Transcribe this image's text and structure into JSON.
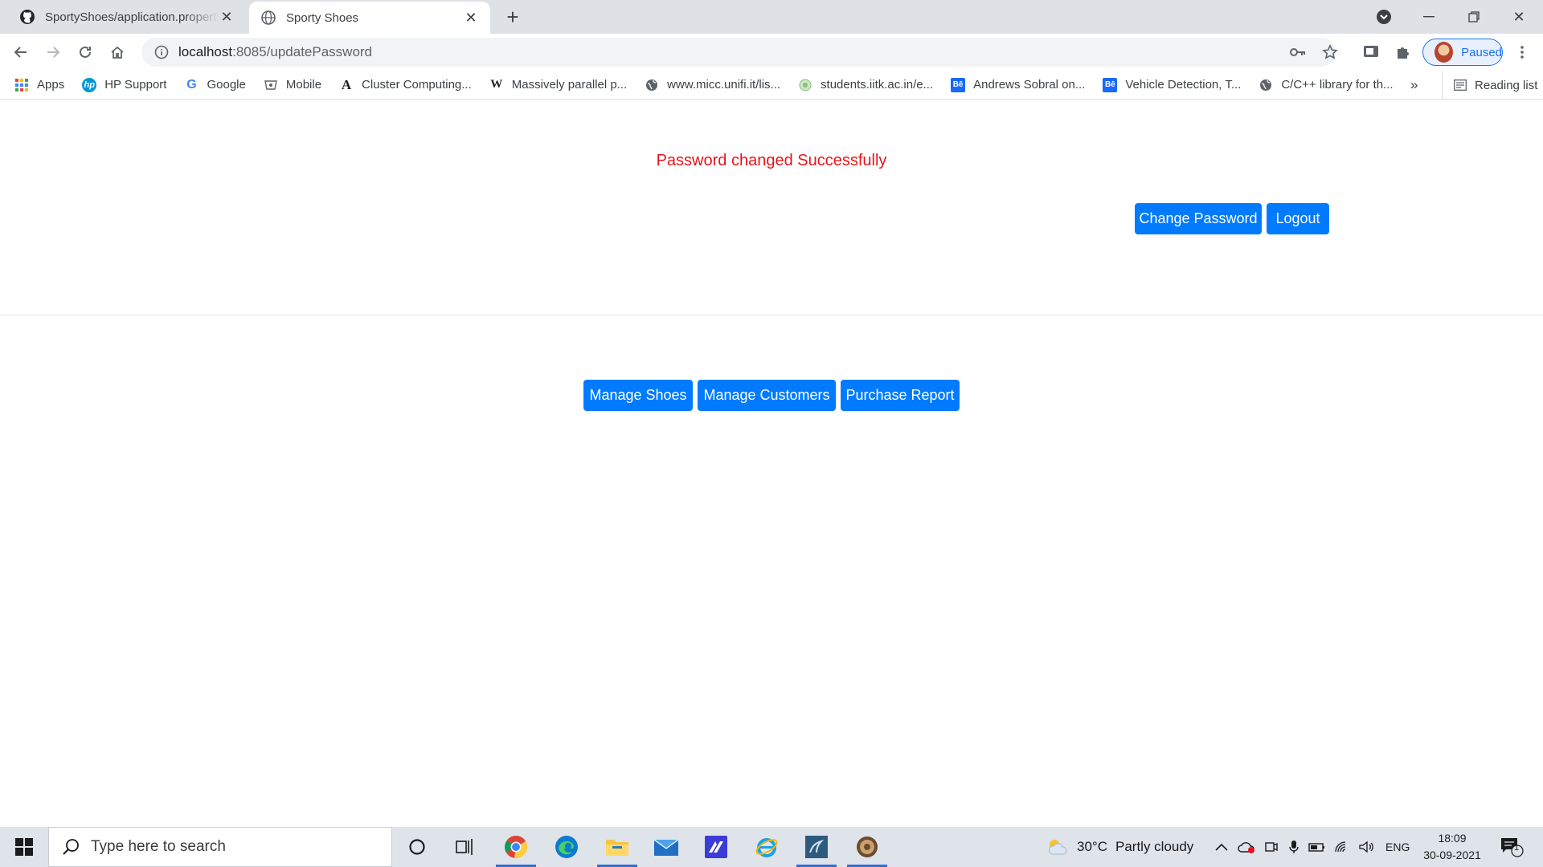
{
  "browser": {
    "tabs": [
      {
        "title": "SportyShoes/application.properties",
        "active": false
      },
      {
        "title": "Sporty Shoes",
        "active": true
      }
    ],
    "url_host": "localhost",
    "url_path": ":8085/updatePassword",
    "profile_label": "Paused"
  },
  "bookmarks": [
    {
      "label": "Apps",
      "icon": "apps-grid-icon"
    },
    {
      "label": "HP Support",
      "icon": "hp-icon"
    },
    {
      "label": "Google",
      "icon": "google-icon"
    },
    {
      "label": "Mobile",
      "icon": "mobile-icon"
    },
    {
      "label": "Cluster Computing...",
      "icon": "a-letter-icon"
    },
    {
      "label": "Massively parallel p...",
      "icon": "wikipedia-icon"
    },
    {
      "label": "www.micc.unifi.it/lis...",
      "icon": "globe-icon"
    },
    {
      "label": "students.iitk.ac.in/e...",
      "icon": "iitk-icon"
    },
    {
      "label": "Andrews Sobral on...",
      "icon": "behance-icon"
    },
    {
      "label": "Vehicle Detection, T...",
      "icon": "behance-icon"
    },
    {
      "label": "C/C++ library for th...",
      "icon": "globe-icon"
    }
  ],
  "bookmarks_more": "»",
  "reading_list": "Reading list",
  "page": {
    "status_message": "Password changed Successfully",
    "header_buttons": {
      "change_password": "Change Password",
      "logout": "Logout"
    },
    "actions": {
      "manage_shoes": "Manage Shoes",
      "manage_customers": "Manage Customers",
      "purchase_report": "Purchase Report"
    }
  },
  "taskbar": {
    "search_placeholder": "Type here to search",
    "weather": {
      "temp": "30°C",
      "condition": "Partly cloudy"
    },
    "language": "ENG",
    "time": "18:09",
    "date": "30-09-2021",
    "notification_count": "1"
  },
  "colors": {
    "primary_button": "#007bff",
    "status_message": "#e8141a"
  }
}
